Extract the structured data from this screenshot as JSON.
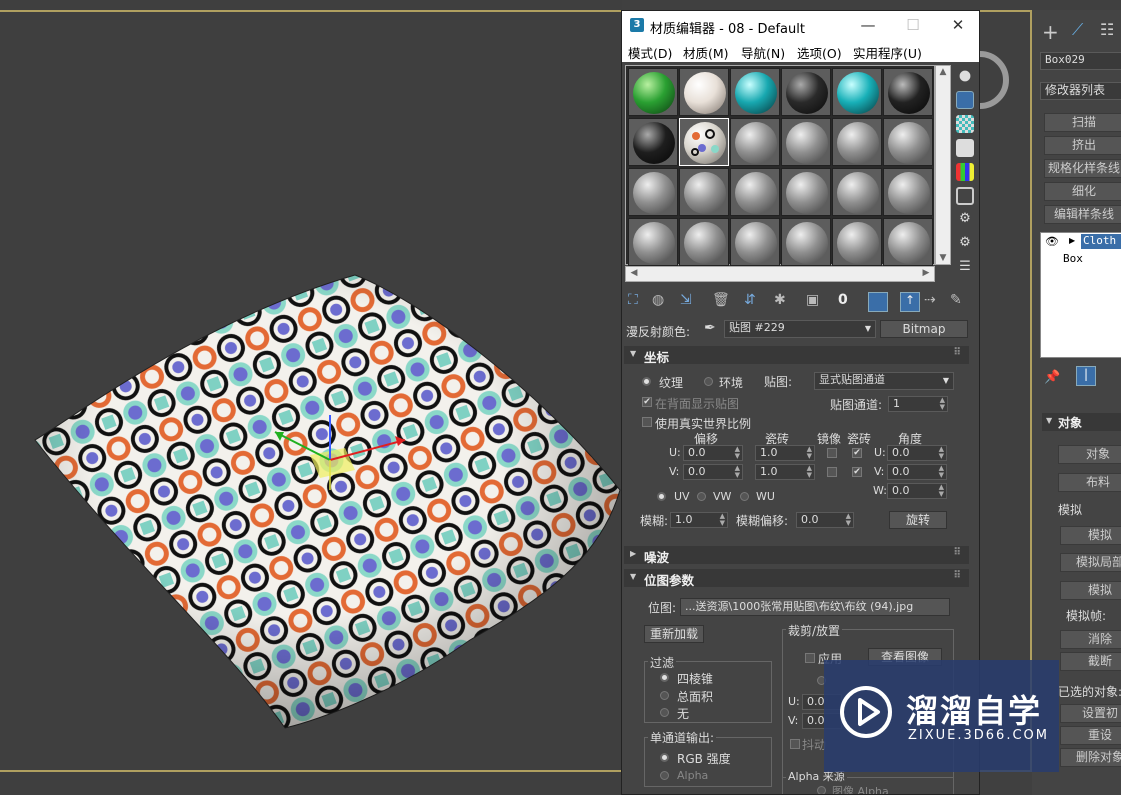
{
  "material_editor": {
    "title": "材质编辑器 - 08 - Default",
    "app_icon": "3",
    "menu": [
      "模式(D)",
      "材质(M)",
      "导航(N)",
      "选项(O)",
      "实用程序(U)"
    ],
    "diffuse_label": "漫反射颜色:",
    "map_name": "贴图 #229",
    "map_type": "Bitmap",
    "coords": {
      "title": "坐标",
      "texture": "纹理",
      "environ": "环境",
      "mapping_label": "贴图:",
      "mapping_value": "显式贴图通道",
      "show_back": "在背面显示贴图",
      "channel_label": "贴图通道:",
      "channel_value": "1",
      "real_world": "使用真实世界比例",
      "col_offset": "偏移",
      "col_tiling": "瓷砖",
      "col_mirror": "镜像",
      "col_tile": "瓷砖",
      "col_angle": "角度",
      "u_label": "U:",
      "v_label": "V:",
      "w_label": "W:",
      "u_offset": "0.0",
      "v_offset": "0.0",
      "u_tiling": "1.0",
      "v_tiling": "1.0",
      "u_angle": "0.0",
      "v_angle": "0.0",
      "w_angle": "0.0",
      "uv": "UV",
      "vw": "VW",
      "wu": "WU",
      "blur_label": "模糊:",
      "blur_value": "1.0",
      "blur_offset_label": "模糊偏移:",
      "blur_offset_value": "0.0",
      "rotate": "旋转"
    },
    "noise_title": "噪波",
    "bitmap": {
      "title": "位图参数",
      "bitmap_label": "位图:",
      "path": "...送资源\\1000张常用贴图\\布纹\\布纹 (94).jpg",
      "reload": "重新加载",
      "crop_title": "裁剪/放置",
      "apply": "应用",
      "view_image": "查看图像",
      "filter_title": "过滤",
      "filter_pyramidal": "四棱锥",
      "filter_sat": "总面积",
      "filter_none": "无",
      "u_lbl": "U:",
      "v_lbl": "V:",
      "u_val": "0.0",
      "v_val": "0.0",
      "jitter": "抖动",
      "mono_title": "单通道输出:",
      "rgb_intensity": "RGB 强度",
      "alpha": "Alpha",
      "alpha_source": "Alpha 来源",
      "image_alpha": "图像 Alpha"
    }
  },
  "command_panel": {
    "object_name": "Box029",
    "modifier_list": "修改器列表",
    "buttons": [
      "扫描",
      "挤出",
      "规格化样条线",
      "细化",
      "编辑样条线"
    ],
    "stack": [
      "Cloth",
      "Box"
    ],
    "object_title": "对象",
    "obj_btn1": "对象",
    "obj_btn2": "布料",
    "sim_label": "模拟",
    "sim_btn1": "模拟",
    "sim_btn2": "模拟局部",
    "sim_btn3": "模拟",
    "sim_frames": "模拟帧:",
    "btn_clear": "消除",
    "btn_cut": "截断",
    "selected_obj": "已选的对象:",
    "set_btn": "设置初",
    "reset_btn": "重设",
    "delete_btn": "删除对象"
  },
  "watermark": {
    "brand": "溜溜自学",
    "url": "ZIXUE.3D66.COM"
  },
  "colors": {
    "viewport_bg": "#3f3f3f",
    "panel_bg": "#444444",
    "frame_border": "#b0a060"
  }
}
